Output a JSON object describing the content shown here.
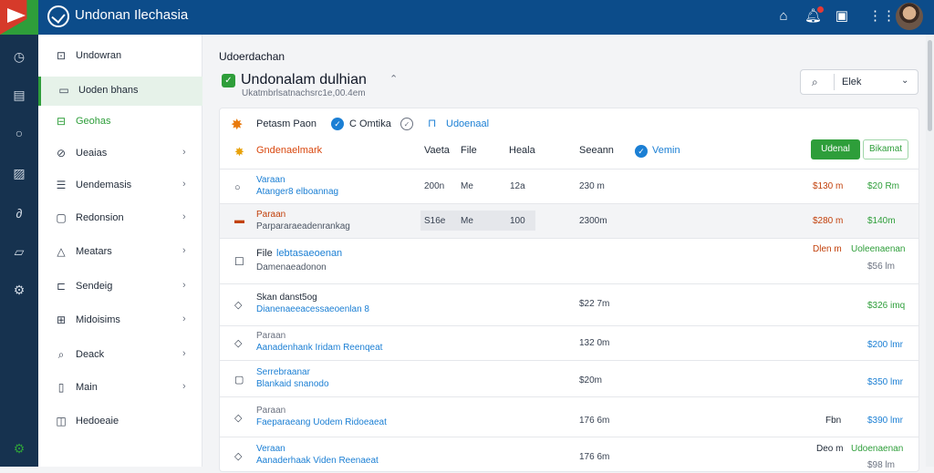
{
  "topbar": {
    "title": "Undonan Ilechasia",
    "icons": [
      "home-icon",
      "notification-icon",
      "window-icon",
      "grid-icon",
      "avatar"
    ]
  },
  "rail": {
    "icons": [
      "clock-icon",
      "book-icon",
      "circle-icon",
      "image-icon",
      "link-icon",
      "map-icon",
      "gear-icon",
      "settings-green-icon"
    ]
  },
  "sidebar": {
    "items": [
      {
        "label": "Undowran",
        "icon": "doc-icon",
        "chevron": false
      },
      {
        "label": "Uoden bhans",
        "icon": "card-icon",
        "chevron": false
      },
      {
        "label": "Geohas",
        "icon": "lock-icon",
        "chevron": false
      },
      {
        "label": "Ueaias",
        "icon": "tag-icon",
        "chevron": true
      },
      {
        "label": "Uendemasis",
        "icon": "list-icon",
        "chevron": true
      },
      {
        "label": "Redonsion",
        "icon": "calendar-icon",
        "chevron": true
      },
      {
        "label": "Meatars",
        "icon": "alert-icon",
        "chevron": true
      },
      {
        "label": "Sendeig",
        "icon": "email-icon",
        "chevron": true
      },
      {
        "label": "Midoisims",
        "icon": "file-icon",
        "chevron": true
      },
      {
        "label": "Deack",
        "icon": "search-icon",
        "chevron": true
      },
      {
        "label": "Main",
        "icon": "page-icon",
        "chevron": true
      },
      {
        "label": "Hedoeaie",
        "icon": "box-icon",
        "chevron": false
      }
    ]
  },
  "main": {
    "breadcrumb": "Udoerdachan",
    "title": "Undonalam dulhian",
    "subtitle": "Ukatmbrlsatnachsrc1e,00.4em",
    "search": {
      "value": "Elek"
    }
  },
  "toolbar": {
    "label1": "Petasm Paon",
    "label2": "C Omtika",
    "link": "Udoenaal"
  },
  "table": {
    "headers": {
      "col0": "Gndenaelmark",
      "col1": "Vaeta",
      "col2": "File",
      "col3": "Heala",
      "col4": "Seeann",
      "col5": "Vemin"
    },
    "actions": {
      "primary": "Udenal",
      "secondary": "Bikamat"
    },
    "rows": [
      {
        "top": "Varaan",
        "bottom": "Atanger8 elboannag",
        "c1": "200n",
        "c2": "Me",
        "c3": "12a",
        "c4": "230 m",
        "a1": "$130 m",
        "a2": "$20 Rm",
        "icon": "radio-icon"
      },
      {
        "top": "Paraan",
        "bottom": "Parpararaeadenrankag",
        "c1": "S16e",
        "c2": "Me",
        "c3": "100",
        "c4": "2300m",
        "a1": "$280 m",
        "a2": "$140m",
        "icon": "flag-icon"
      },
      {
        "top": "File",
        "top2": "lebtasaeoenan",
        "bottom": "Damenaeadonon",
        "a1": "Dlen m",
        "a2": "Uoleenaenan",
        "a3": "$56 lm",
        "icon": "checkbox-icon"
      },
      {
        "top": "Skan danst5og",
        "bottom": "Dianenaeeacessaeoenlan 8",
        "c4": "$22 7m",
        "a2": "$326 imq",
        "icon": "diamond-icon"
      },
      {
        "top": "Paraan",
        "bottom": "Aanadenhank Iridam Reenqeat",
        "c4": "132 0m",
        "a2": "$200 lmr",
        "icon": "diamond-icon"
      },
      {
        "top": "Serrebraanar",
        "bottom": "Blankaid snanodo",
        "c4": "$20m",
        "a2": "$350 lmr",
        "icon": "square-icon"
      },
      {
        "top": "Paraan",
        "bottom": "Faeparaeang Uodem Ridoeaeat",
        "c4": "176 6m",
        "a1": "Fbn",
        "a2": "$390 lmr",
        "icon": "diamond-icon"
      },
      {
        "top": "Veraan",
        "bottom": "Aanaderhaak Viden Reenaeat",
        "c4": "176 6m",
        "a1": "Deo m",
        "a2": "Udoenaenan",
        "a3": "$98 lm",
        "icon": "diamond-icon"
      }
    ]
  },
  "colors": {
    "topbar": "#0c4c8a",
    "rail": "#16324f",
    "accent": "#2e9e3a",
    "link": "#1b7fd4",
    "warn": "#c2410c"
  }
}
